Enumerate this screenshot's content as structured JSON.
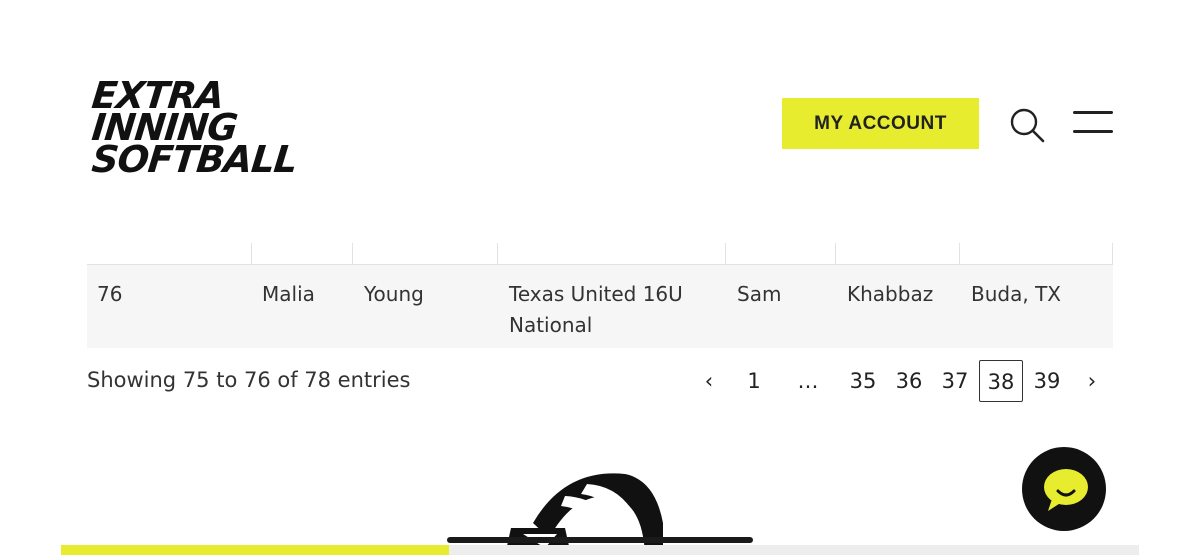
{
  "header": {
    "logo_lines": [
      "EXTRA",
      "INNING",
      "SOFTBALL"
    ],
    "account_button": "MY ACCOUNT",
    "search_icon": "search-icon",
    "menu_icon": "hamburger-menu-icon"
  },
  "table": {
    "row": {
      "number": "76",
      "first_name": "Malia",
      "last_name": "Young",
      "team": "Texas United 16U National",
      "coach_first": "Sam",
      "coach_last": "Khabbaz",
      "location": "Buda, TX"
    }
  },
  "footer": {
    "info": "Showing 75 to 76 of 78 entries",
    "pagination": {
      "prev": "‹",
      "pages": [
        "1",
        "…",
        "35",
        "36",
        "37",
        "38",
        "39"
      ],
      "current": "38",
      "next": "›"
    }
  },
  "widgets": {
    "chat_icon": "chat-bubble-icon",
    "scroll_progress": 0.36
  },
  "colors": {
    "accent": "#e8ec2f",
    "dark": "#111111"
  }
}
